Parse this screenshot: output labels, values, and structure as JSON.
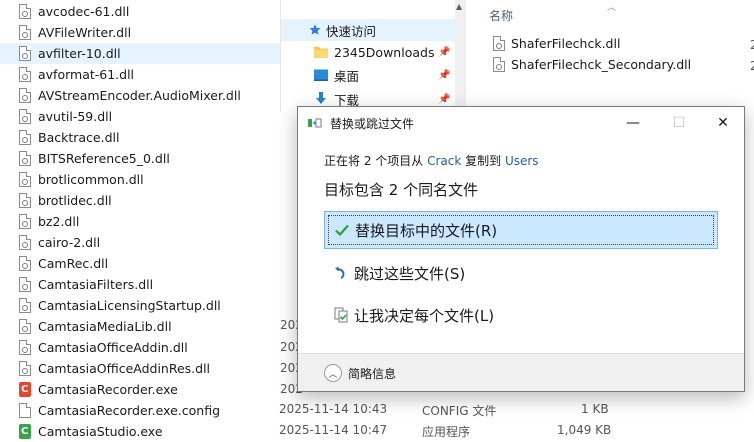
{
  "file_list": [
    {
      "name": "avcodec-61.dll",
      "type": "dll"
    },
    {
      "name": "AVFileWriter.dll",
      "type": "dll"
    },
    {
      "name": "avfilter-10.dll",
      "type": "dll",
      "selected": true
    },
    {
      "name": "avformat-61.dll",
      "type": "dll"
    },
    {
      "name": "AVStreamEncoder.AudioMixer.dll",
      "type": "dll"
    },
    {
      "name": "avutil-59.dll",
      "type": "dll"
    },
    {
      "name": "Backtrace.dll",
      "type": "dll"
    },
    {
      "name": "BITSReference5_0.dll",
      "type": "dll"
    },
    {
      "name": "brotlicommon.dll",
      "type": "dll"
    },
    {
      "name": "brotlidec.dll",
      "type": "dll"
    },
    {
      "name": "bz2.dll",
      "type": "dll"
    },
    {
      "name": "cairo-2.dll",
      "type": "dll"
    },
    {
      "name": "CamRec.dll",
      "type": "dll"
    },
    {
      "name": "CamtasiaFilters.dll",
      "type": "dll"
    },
    {
      "name": "CamtasiaLicensingStartup.dll",
      "type": "dll"
    },
    {
      "name": "CamtasiaMediaLib.dll",
      "type": "dll"
    },
    {
      "name": "CamtasiaOfficeAddin.dll",
      "type": "dll"
    },
    {
      "name": "CamtasiaOfficeAddinRes.dll",
      "type": "dll"
    },
    {
      "name": "CamtasiaRecorder.exe",
      "type": "exe-red"
    },
    {
      "name": "CamtasiaRecorder.exe.config",
      "type": "plain"
    },
    {
      "name": "CamtasiaStudio.exe",
      "type": "exe-green"
    }
  ],
  "partial_columns": {
    "date_fragments": [
      "202",
      "202",
      "202",
      "202"
    ],
    "config_row": {
      "date": "2025-11-14 10:43",
      "type": "CONFIG 文件",
      "size": "1 KB"
    },
    "studio_row": {
      "date": "2025-11-14 10:47",
      "type": "应用程序",
      "size": "1,049 KB"
    }
  },
  "nav": {
    "quick_access": "快速访问",
    "items": [
      {
        "label": "2345Downloads"
      },
      {
        "label": "桌面"
      },
      {
        "label": "下载"
      }
    ]
  },
  "right_pane": {
    "column_header": "名称",
    "files": [
      "ShaferFilechck.dll",
      "ShaferFilechck_Secondary.dll"
    ],
    "edge_digit": "2"
  },
  "dialog": {
    "title": "替换或跳过文件",
    "line1_prefix": "正在将 2 个项目从 ",
    "source": "Crack",
    "line1_mid": " 复制到 ",
    "destination": "Users",
    "heading": "目标包含 2 个同名文件",
    "options": [
      {
        "label": "替换目标中的文件(R)",
        "icon": "check-icon"
      },
      {
        "label": "跳过这些文件(S)",
        "icon": "skip-icon"
      },
      {
        "label": "让我决定每个文件(L)",
        "icon": "decide-icon"
      }
    ],
    "more_details": "简略信息",
    "colors": {
      "accent": "#1e5fa8",
      "focus_bg": "#cce8ff",
      "check": "#2e9e3b"
    }
  }
}
